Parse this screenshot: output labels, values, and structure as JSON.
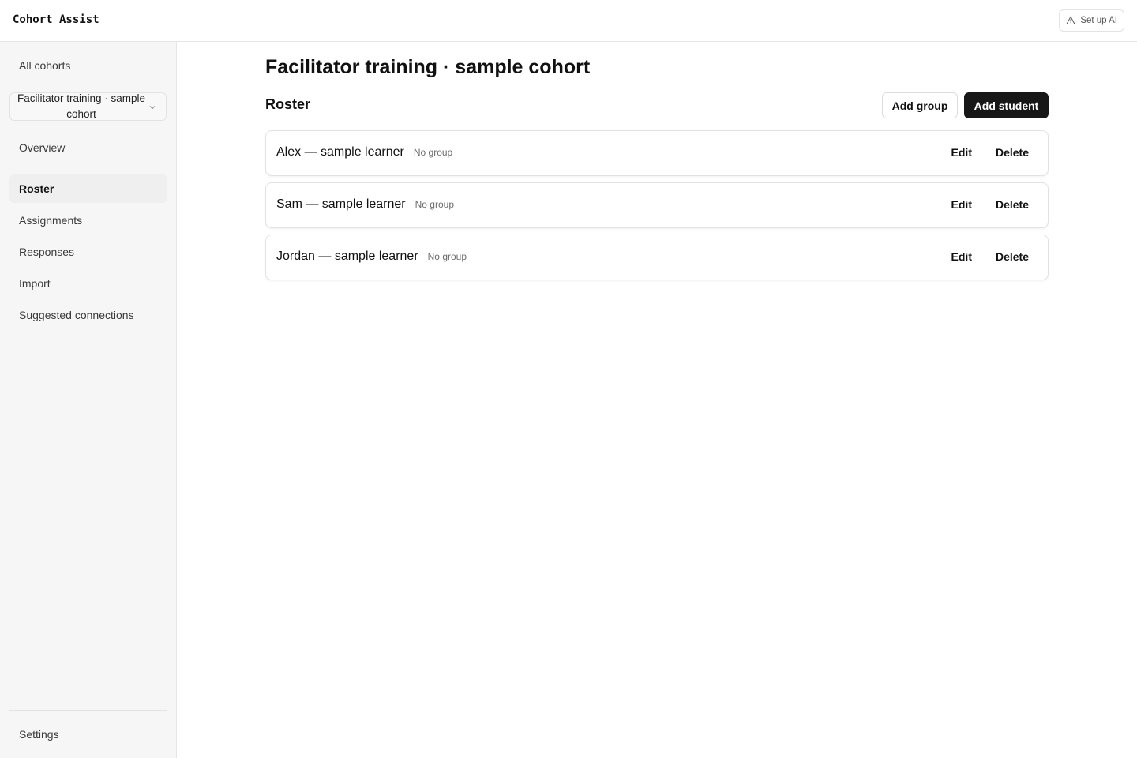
{
  "app": {
    "title": "Cohort Assist",
    "setup_ai_label": "Set up AI"
  },
  "sidebar": {
    "all_cohorts": "All cohorts",
    "cohort_selector": {
      "value": "Facilitator training · sample cohort"
    },
    "items": [
      {
        "label": "Overview",
        "active": false
      },
      {
        "label": "Roster",
        "active": true
      },
      {
        "label": "Assignments",
        "active": false
      },
      {
        "label": "Responses",
        "active": false
      },
      {
        "label": "Import",
        "active": false
      },
      {
        "label": "Suggested connections",
        "active": false
      }
    ],
    "settings": "Settings"
  },
  "main": {
    "page_title": "Facilitator training · sample cohort",
    "section_title": "Roster",
    "add_group_label": "Add group",
    "add_student_label": "Add student",
    "students": [
      {
        "name": "Alex — sample learner",
        "group": "No group",
        "edit": "Edit",
        "delete": "Delete"
      },
      {
        "name": "Sam — sample learner",
        "group": "No group",
        "edit": "Edit",
        "delete": "Delete"
      },
      {
        "name": "Jordan — sample learner",
        "group": "No group",
        "edit": "Edit",
        "delete": "Delete"
      }
    ]
  },
  "colors": {
    "accent_dark": "#171717",
    "sidebar_bg": "#f6f6f6",
    "border": "#e2e2e2"
  }
}
